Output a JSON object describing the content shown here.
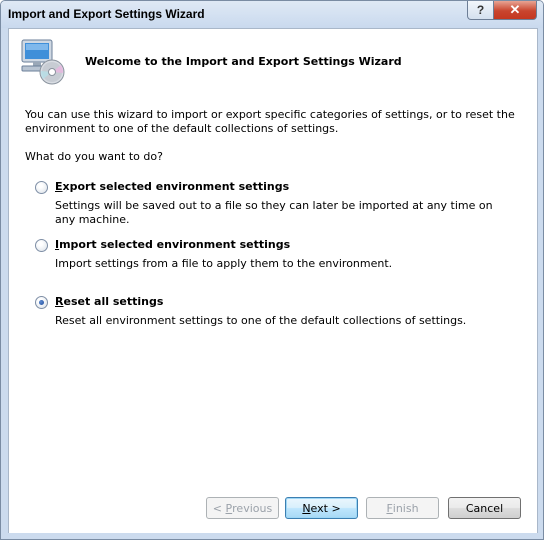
{
  "window": {
    "title": "Import and Export Settings Wizard",
    "help_label": "?",
    "close_label": "✕"
  },
  "header": {
    "title": "Welcome to the Import and Export Settings Wizard",
    "icon": "computer-disc-icon"
  },
  "intro": "You can use this wizard to import or export specific categories of settings, or to reset the environment to one of the default collections of settings.",
  "question": "What do you want to do?",
  "options": [
    {
      "label_key": "E",
      "label_rest": "xport selected environment settings",
      "description": "Settings will be saved out to a file so they can later be imported at any time on any machine.",
      "checked": false
    },
    {
      "label_key": "I",
      "label_rest": "mport selected environment settings",
      "description": "Import settings from a file to apply them to the environment.",
      "checked": false
    },
    {
      "label_key": "R",
      "label_rest": "eset all settings",
      "description": "Reset all environment settings to one of the default collections of settings.",
      "checked": true
    }
  ],
  "buttons": {
    "previous": {
      "prefix": "< ",
      "key": "P",
      "rest": "revious"
    },
    "next": {
      "key": "N",
      "rest": "ext >"
    },
    "finish": {
      "key": "F",
      "rest": "inish"
    },
    "cancel": "Cancel"
  }
}
